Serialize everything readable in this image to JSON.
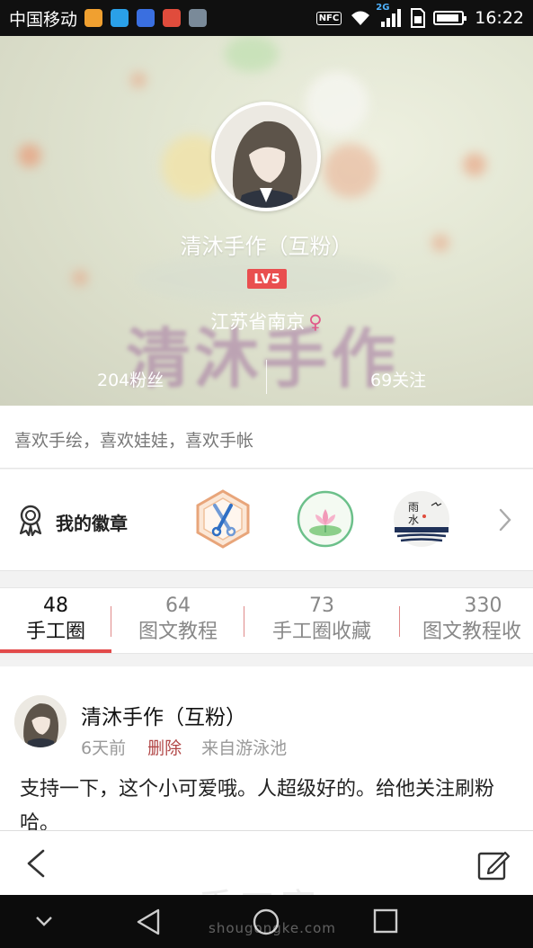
{
  "status_bar": {
    "carrier": "中国移动",
    "network_type": "2G",
    "time": "16:22",
    "nfc_label": "NFC"
  },
  "profile": {
    "nickname": "清沐手作（互粉）",
    "level": "LV5",
    "location": "江苏省南京",
    "gender_symbol": "♀",
    "followers": "204粉丝",
    "following": "69关注",
    "bio": "喜欢手绘，喜欢娃娃，喜欢手帐",
    "background_text": "清沐手作"
  },
  "badges": {
    "label": "我的徽章",
    "items": [
      {
        "name": "scissors-badge"
      },
      {
        "name": "lotus-badge"
      },
      {
        "name": "rain-water-badge",
        "text": "雨水"
      }
    ]
  },
  "tabs": [
    {
      "count": "48",
      "label": "手工圈",
      "active": true
    },
    {
      "count": "64",
      "label": "图文教程",
      "active": false
    },
    {
      "count": "73",
      "label": "手工圈收藏",
      "active": false
    },
    {
      "count": "330",
      "label": "图文教程收",
      "active": false
    }
  ],
  "post": {
    "author": "清沐手作（互粉）",
    "time": "6天前",
    "delete_label": "删除",
    "source": "来自游泳池",
    "text": "支持一下，这个小可爱哦。人超级好的。给他关注刷粉哈。"
  },
  "watermark": {
    "text": "手工客",
    "url": "shougongke.com"
  },
  "colors": {
    "accent": "#e24a4a",
    "status_bar": "#101010",
    "level_badge": "#e94f4f"
  }
}
